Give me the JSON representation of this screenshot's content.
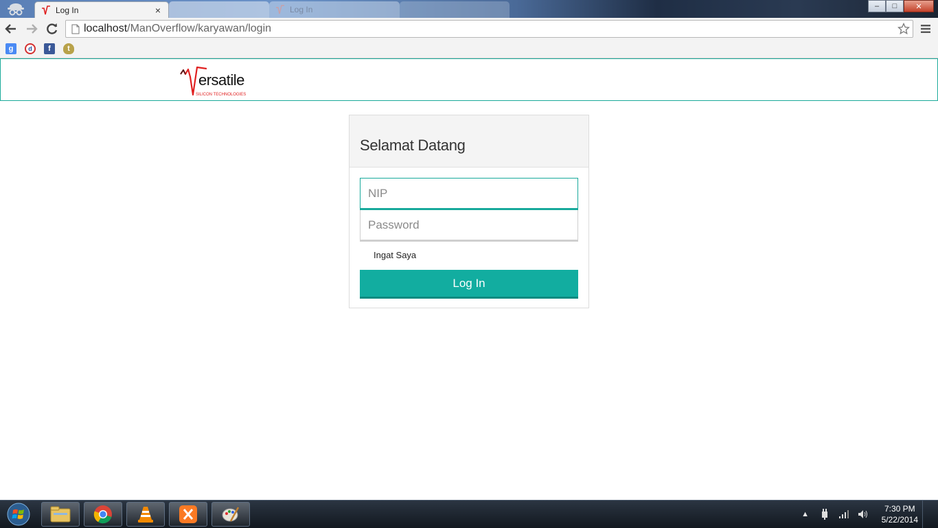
{
  "browser": {
    "tabs": [
      {
        "title": "Log In",
        "active": true
      },
      {
        "title": "",
        "active": false
      },
      {
        "title": "Log In",
        "active": false
      },
      {
        "title": "",
        "active": false
      }
    ],
    "active_tab_close": "×",
    "url_host": "localhost",
    "url_path": "/ManOverflow/karyawan/login",
    "window_controls": {
      "minimize": "–",
      "maximize": "□",
      "close": "✕"
    },
    "bookmarks": [
      {
        "icon": "google-bookmark-icon",
        "glyph": "g"
      },
      {
        "icon": "d-bookmark-icon",
        "glyph": "d"
      },
      {
        "icon": "facebook-bookmark-icon",
        "glyph": "f"
      },
      {
        "icon": "shield-bookmark-icon",
        "glyph": "t"
      }
    ]
  },
  "header": {
    "logo_word": "ersatile",
    "logo_tag_red": "SILICON",
    "logo_tag_rest": " TECHNOLOGIES"
  },
  "login": {
    "title": "Selamat Datang",
    "nip_placeholder": "NIP",
    "password_placeholder": "Password",
    "remember_label": "Ingat Saya",
    "submit_label": "Log In"
  },
  "taskbar": {
    "apps": [
      "file-explorer-icon",
      "chrome-icon",
      "vlc-icon",
      "xampp-icon",
      "paint-icon"
    ],
    "time": "7:30 PM",
    "date": "5/22/2014"
  },
  "colors": {
    "accent": "#12ada0",
    "header_border": "#1aaa9a",
    "logo_red": "#e02020"
  }
}
